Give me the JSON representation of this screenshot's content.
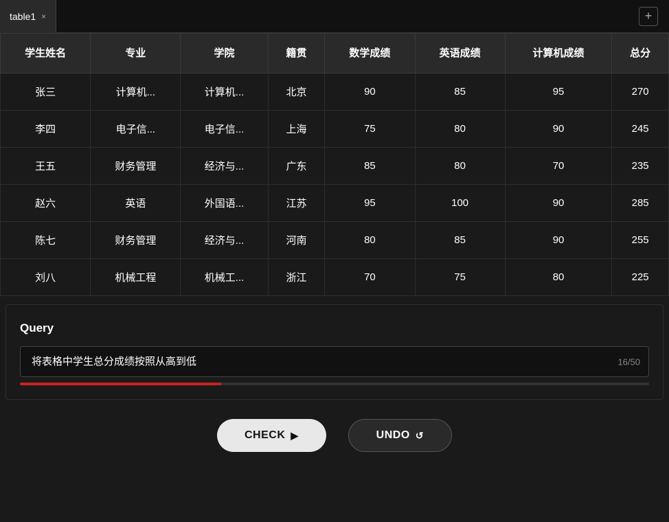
{
  "tab": {
    "label": "table1",
    "close_icon": "×",
    "add_icon": "+"
  },
  "table": {
    "headers": [
      "学生姓名",
      "专业",
      "学院",
      "籍贯",
      "数学成绩",
      "英语成绩",
      "计算机成绩",
      "总分"
    ],
    "rows": [
      [
        "张三",
        "计算机...",
        "计算机...",
        "北京",
        "90",
        "85",
        "95",
        "270"
      ],
      [
        "李四",
        "电子信...",
        "电子信...",
        "上海",
        "75",
        "80",
        "90",
        "245"
      ],
      [
        "王五",
        "财务管理",
        "经济与...",
        "广东",
        "85",
        "80",
        "70",
        "235"
      ],
      [
        "赵六",
        "英语",
        "外国语...",
        "江苏",
        "95",
        "100",
        "90",
        "285"
      ],
      [
        "陈七",
        "财务管理",
        "经济与...",
        "河南",
        "80",
        "85",
        "90",
        "255"
      ],
      [
        "刘八",
        "机械工程",
        "机械工...",
        "浙江",
        "70",
        "75",
        "80",
        "225"
      ]
    ]
  },
  "query": {
    "label": "Query",
    "input_value": "将表格中学生总分成绩按照从高到低",
    "counter": "16/50",
    "progress_percent": 32
  },
  "buttons": {
    "check_label": "CHECK",
    "check_icon": "▶",
    "undo_label": "UNDO",
    "undo_icon": "↺"
  }
}
